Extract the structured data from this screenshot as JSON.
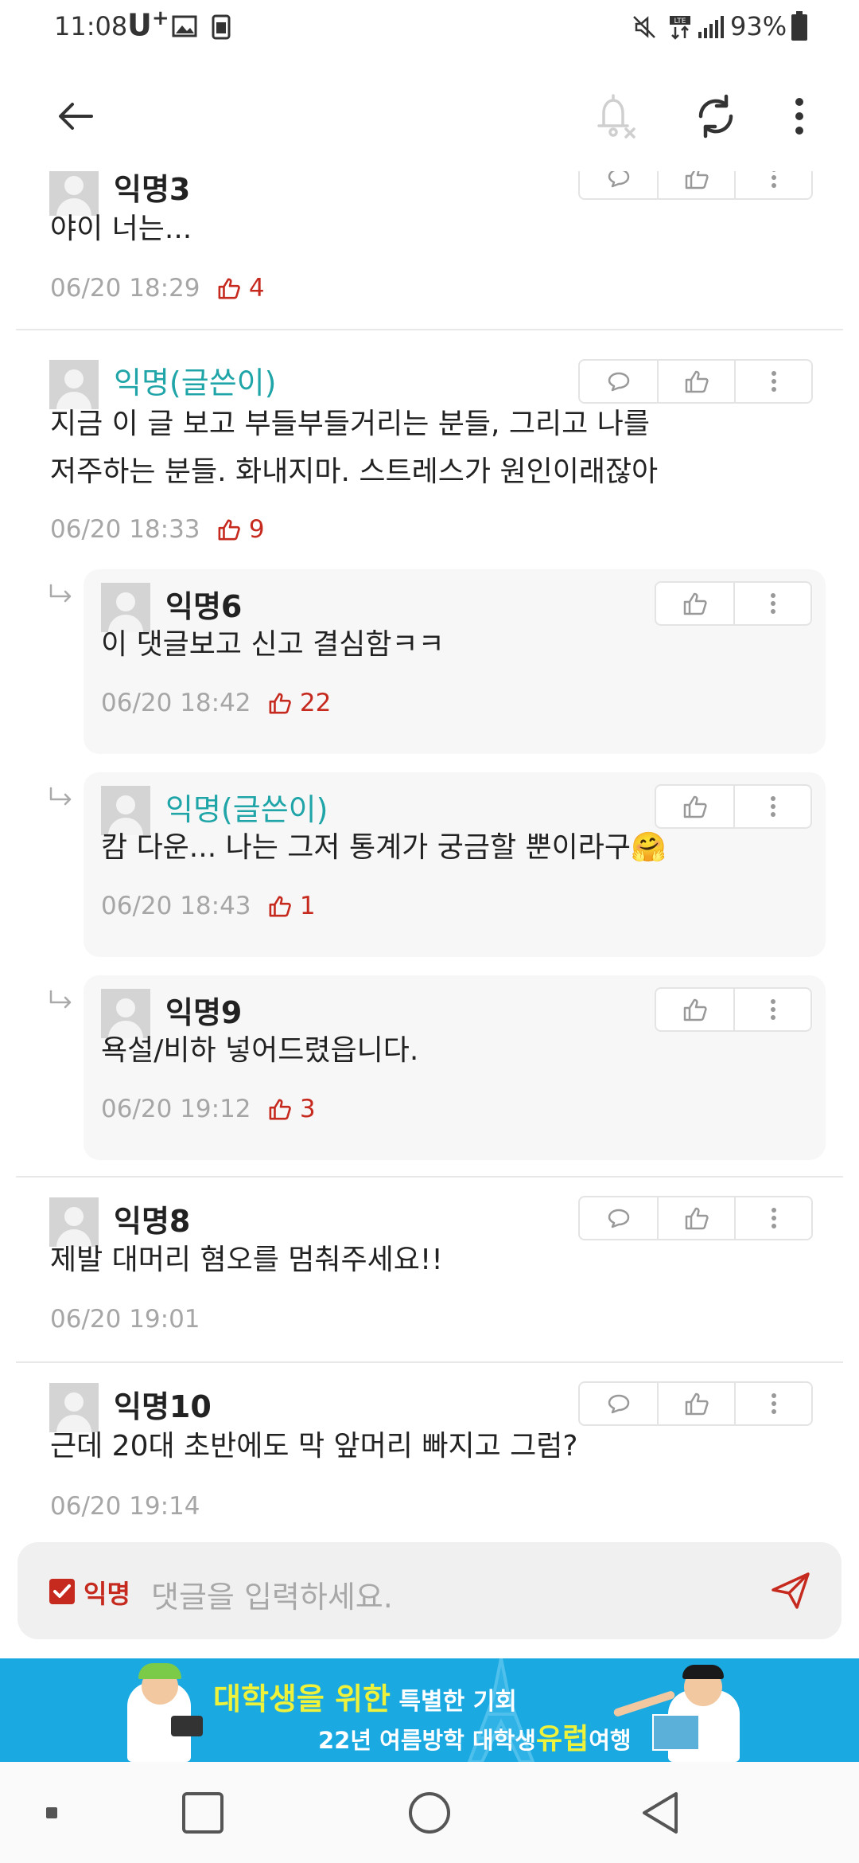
{
  "status": {
    "time": "11:08",
    "carrier": "U",
    "carrier_sup": "+",
    "battery": "93%"
  },
  "appbar": {
    "back_icon": "arrow-left-icon",
    "mute_icon": "bell-off-icon",
    "refresh_icon": "refresh-icon",
    "more_icon": "more-vertical-icon"
  },
  "comments": [
    {
      "author": "익명3",
      "text": "야이 너는...",
      "datetime": "06/20 18:29",
      "likes": "4",
      "writer": false
    },
    {
      "author": "익명(글쓴이)",
      "text_line1": "지금 이 글 보고 부들부들거리는 분들, 그리고 나를",
      "text_line2": "저주하는 분들. 화내지마. 스트레스가 원인이래잖아",
      "datetime": "06/20 18:33",
      "likes": "9",
      "writer": true
    },
    {
      "author": "익명8",
      "text": "제발 대머리 혐오를 멈춰주세요!!",
      "datetime": "06/20 19:01",
      "writer": false
    },
    {
      "author": "익명10",
      "text": "근데 20대 초반에도 막 앞머리 빠지고 그럼?",
      "datetime": "06/20 19:14",
      "writer": false
    }
  ],
  "replies": [
    {
      "author": "익명6",
      "text": "이 댓글보고 신고 결심함ㅋㅋ",
      "datetime": "06/20 18:42",
      "likes": "22",
      "writer": false
    },
    {
      "author": "익명(글쓴이)",
      "text": "캄 다운... 나는 그저 통계가 궁금할 뿐이라구",
      "emoji": "🤗",
      "datetime": "06/20 18:43",
      "likes": "1",
      "writer": true
    },
    {
      "author": "익명9",
      "text": "욕설/비하 넣어드렸읍니다.",
      "datetime": "06/20 19:12",
      "likes": "3",
      "writer": false
    }
  ],
  "input": {
    "anonymous_label": "익명",
    "anonymous_checked": true,
    "placeholder": "댓글을 입력하세요."
  },
  "banner": {
    "line1_a": "대학생을 위한",
    "line1_b": " 특별한 기회",
    "line2_a": "22년 여름방학 대학생",
    "line2_b": "유럽",
    "line2_c": "여행"
  },
  "colors": {
    "accent_red": "#c62a1f",
    "writer_teal": "#1fa5a8",
    "banner_blue": "#1aa9e1"
  }
}
